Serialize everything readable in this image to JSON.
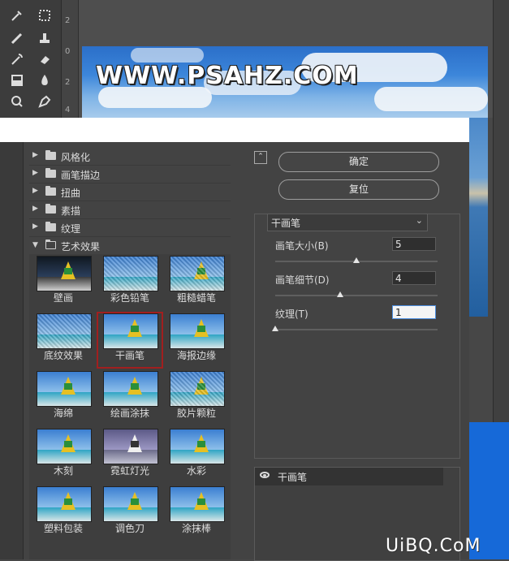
{
  "workspace": {
    "ruler_marks": [
      "2",
      "0",
      "2",
      "4"
    ],
    "canvas_watermark": "WWW.PSAHZ.COM"
  },
  "filter_gallery": {
    "categories": [
      {
        "label": "风格化",
        "expanded": false
      },
      {
        "label": "画笔描边",
        "expanded": false
      },
      {
        "label": "扭曲",
        "expanded": false
      },
      {
        "label": "素描",
        "expanded": false
      },
      {
        "label": "纹理",
        "expanded": false
      },
      {
        "label": "艺术效果",
        "expanded": true
      }
    ],
    "artistic_filters": [
      "壁画",
      "彩色铅笔",
      "粗糙蜡笔",
      "底纹效果",
      "干画笔",
      "海报边缘",
      "海绵",
      "绘画涂抹",
      "胶片颗粒",
      "木刻",
      "霓虹灯光",
      "水彩",
      "塑料包装",
      "调色刀",
      "涂抹棒"
    ],
    "selected_filter": "干画笔"
  },
  "controls": {
    "ok_label": "确定",
    "reset_label": "复位",
    "filter_select_value": "干画笔",
    "params": [
      {
        "label": "画笔大小(B)",
        "value": "5",
        "slider_fraction": 0.5
      },
      {
        "label": "画笔细节(D)",
        "value": "4",
        "slider_fraction": 0.4
      },
      {
        "label": "纹理(T)",
        "value": "1",
        "slider_fraction": 0.0
      }
    ]
  },
  "effect_layers": [
    {
      "name": "干画笔",
      "visible": true
    }
  ],
  "site_watermark": "UiBQ.CoM"
}
